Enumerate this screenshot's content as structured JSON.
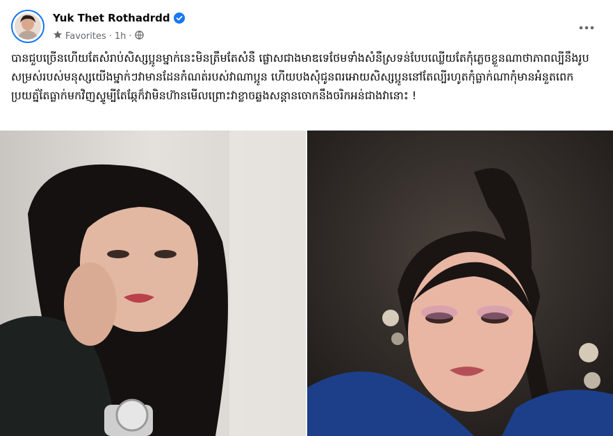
{
  "post": {
    "author": "Yuk Thet Rothadrdd",
    "audience_label": "Favorites",
    "separator": "·",
    "time": "1h",
    "text": "បានជួបច្រើនហើយតែសំរាប់សិស្សប្អូនម្នាក់នេះមិនត្រឹមតែសំនឺ​ ផ្លោសជាងមាឌទេថែមទាំងសំនឺស្រទន់បែបឈ្លើយតែកុំភ្លេចខ្លួនណាថាភាពល្បីនឹងរូបសម្រស់របស់មនុស្សយើងម្នាក់ៗវាមានដែនកំណត់របស់វាណាប្អូន ហើយបងសុំជូនពរអោយសិស្សប្អូននៅតែល្បីរហូតកុំធ្លាក់ណាកុំមានអំនួតពេកប្រយត្ន័តែធ្លាក់មកវិញស្ទូម្បីតែឆ្កែក៏វាមិនហ៊ានមើលព្រោះវាខ្លាចឆ្លងសន្ដានចោកនឹងចរិកអន់ជាងវានោះ !"
  },
  "icons": {
    "verified": "verified-badge-icon",
    "favorites": "star-icon",
    "audience": "globe-icon",
    "more": "more-options-icon"
  },
  "colors": {
    "accent": "#1877f2",
    "meta_text": "#65676b",
    "text": "#050505"
  }
}
